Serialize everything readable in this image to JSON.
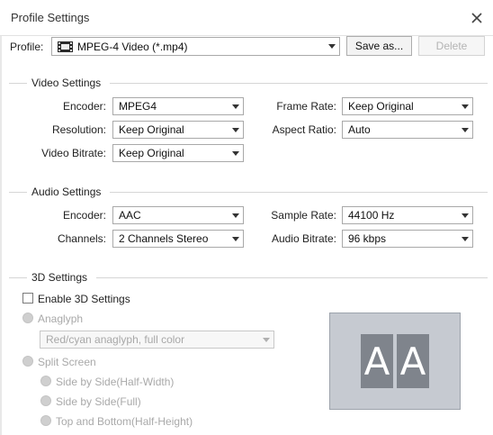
{
  "window": {
    "title": "Profile Settings"
  },
  "profile": {
    "label": "Profile:",
    "value": "MPEG-4 Video (*.mp4)",
    "icon": "mpeg4-icon",
    "save_as": "Save as...",
    "delete": "Delete"
  },
  "video": {
    "title": "Video Settings",
    "encoder_label": "Encoder:",
    "encoder_value": "MPEG4",
    "frame_rate_label": "Frame Rate:",
    "frame_rate_value": "Keep Original",
    "resolution_label": "Resolution:",
    "resolution_value": "Keep Original",
    "aspect_ratio_label": "Aspect Ratio:",
    "aspect_ratio_value": "Auto",
    "bitrate_label": "Video Bitrate:",
    "bitrate_value": "Keep Original"
  },
  "audio": {
    "title": "Audio Settings",
    "encoder_label": "Encoder:",
    "encoder_value": "AAC",
    "sample_rate_label": "Sample Rate:",
    "sample_rate_value": "44100 Hz",
    "channels_label": "Channels:",
    "channels_value": "2 Channels Stereo",
    "bitrate_label": "Audio Bitrate:",
    "bitrate_value": "96 kbps"
  },
  "three_d": {
    "title": "3D Settings",
    "enable_label": "Enable 3D Settings",
    "enabled": false,
    "anaglyph_label": "Anaglyph",
    "anaglyph_value": "Red/cyan anaglyph, full color",
    "split_screen_label": "Split Screen",
    "side_half_label": "Side by Side(Half-Width)",
    "side_full_label": "Side by Side(Full)",
    "top_bottom_label": "Top and Bottom(Half-Height)",
    "preview_letters": [
      "A",
      "A"
    ]
  },
  "colors": {
    "preview_bg": "#c6cad1",
    "preview_letter_bg": "#7f848c",
    "disabled_text": "#a9a9a9"
  }
}
